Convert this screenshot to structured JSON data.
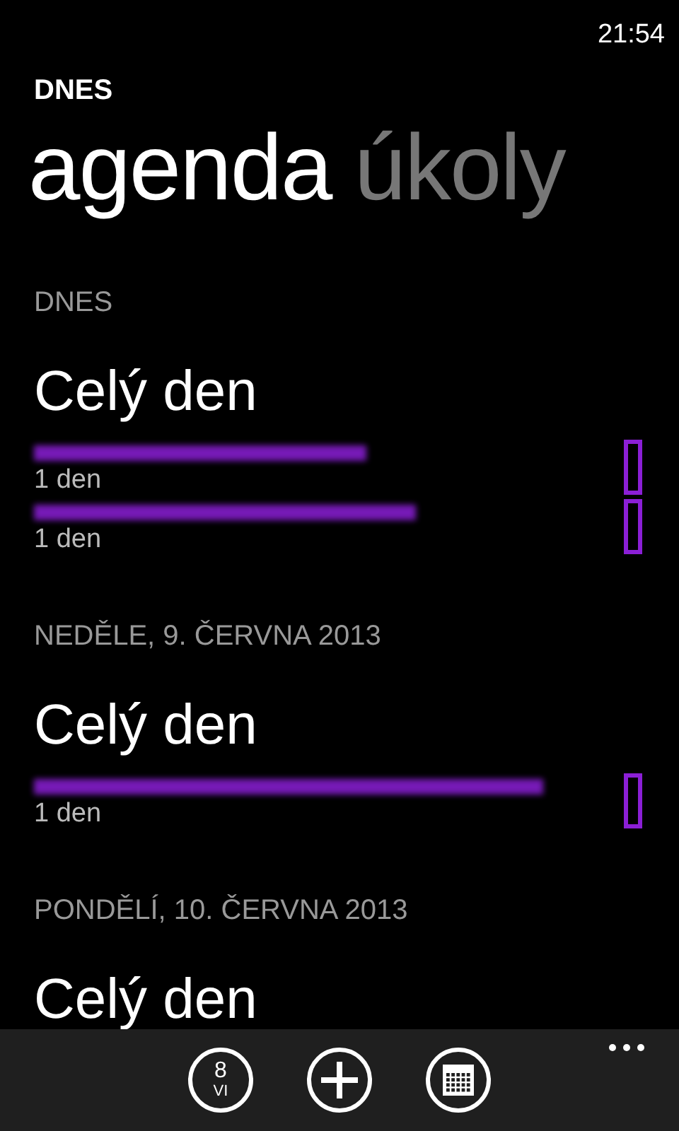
{
  "status_bar": {
    "time": "21:54"
  },
  "app_title": "DNES",
  "pivot": [
    {
      "label": "agenda",
      "selected": true
    },
    {
      "label": "úkoly",
      "selected": false
    }
  ],
  "sections": [
    {
      "header": "DNES",
      "groups": [
        {
          "title": "Celý den",
          "events": [
            {
              "title_redacted": true,
              "duration": "1 den",
              "color": "#8b1fd6"
            },
            {
              "title_redacted": true,
              "duration": "1 den",
              "color": "#8b1fd6"
            }
          ]
        }
      ]
    },
    {
      "header": "NEDĚLE, 9. ČERVNA 2013",
      "groups": [
        {
          "title": "Celý den",
          "events": [
            {
              "title_redacted": true,
              "duration": "1 den",
              "color": "#8b1fd6"
            }
          ]
        }
      ]
    },
    {
      "header": "PONDĚLÍ, 10. ČERVNA 2013",
      "groups": [
        {
          "title": "Celý den"
        }
      ]
    }
  ],
  "app_bar": {
    "buttons": [
      {
        "kind": "today",
        "day": "8",
        "month": "VI"
      },
      {
        "kind": "add"
      },
      {
        "kind": "month"
      }
    ]
  }
}
